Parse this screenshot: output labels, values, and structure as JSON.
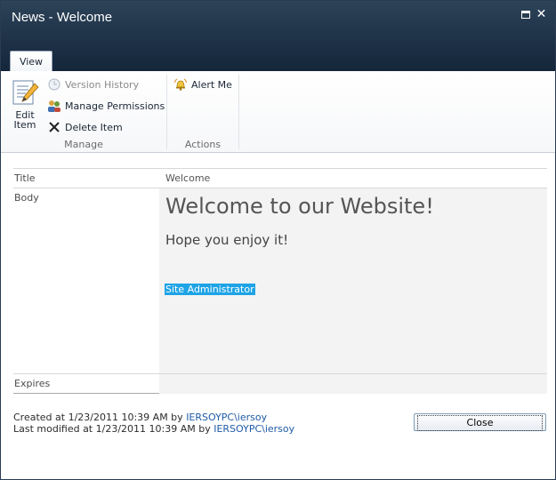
{
  "window": {
    "title": "News - Welcome"
  },
  "ribbon": {
    "tabs": [
      {
        "label": "View"
      }
    ],
    "manage": {
      "label": "Manage",
      "edit_item": "Edit Item",
      "version_history": "Version History",
      "manage_permissions": "Manage Permissions",
      "delete_item": "Delete Item"
    },
    "actions": {
      "label": "Actions",
      "alert_me": "Alert Me"
    }
  },
  "fields": {
    "title": {
      "label": "Title",
      "value": "Welcome"
    },
    "body": {
      "label": "Body",
      "heading": "Welcome to our Website!",
      "subheading": "Hope you enjoy it!",
      "signature": "Site Administrator"
    },
    "expires": {
      "label": "Expires",
      "value": ""
    }
  },
  "footer": {
    "created_prefix": "Created at 1/23/2011 10:39 AM  by ",
    "created_by": "IERSOYPC\\iersoy",
    "modified_prefix": "Last modified at 1/23/2011 10:39 AM  by ",
    "modified_by": "IERSOYPC\\iersoy",
    "close_label": "Close"
  },
  "colors": {
    "titlebar": "#1f3349",
    "link": "#1f5ba6",
    "highlight": "#1ea3e6"
  }
}
